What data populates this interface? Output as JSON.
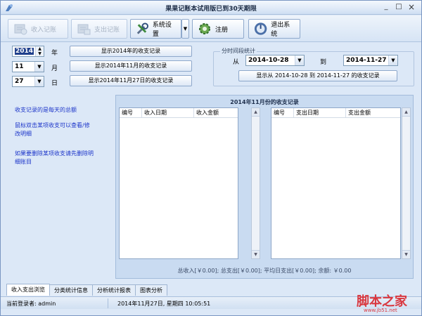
{
  "window": {
    "title": "果果记账本试用版已到30天期限",
    "minimize": "_",
    "maximize": "□",
    "close": "×"
  },
  "toolbar": {
    "income_record": "收入记账",
    "expense_record": "支出记账",
    "settings": "系统设置",
    "settings_drop": "▼",
    "register": "注册",
    "exit": "退出系统"
  },
  "date_selector": {
    "year": "2014",
    "year_unit": "年",
    "month": "11",
    "month_unit": "月",
    "day": "27",
    "day_unit": "日",
    "show_year_btn": "显示2014年的收支记录",
    "show_month_btn": "显示2014年11月的收支记录",
    "show_day_btn": "显示2014年11月27日的收支记录"
  },
  "period": {
    "legend": "分时间段统计",
    "from_label": "从",
    "from_date": "2014-10-28",
    "to_label": "到",
    "to_date": "2014-11-27",
    "show_btn": "显示从 2014-10-28 到 2014-11-27 的收支记录"
  },
  "tips": {
    "line1": "收支记录的是每天的总额",
    "line2a": "鼠标双击某项收支可以查看/修",
    "line2b": "改明细",
    "line3a": "如果要删除某项收支请先删除明",
    "line3b": "细账目"
  },
  "panel": {
    "title": "2014年11月份的收支记录",
    "income_columns": [
      "编号",
      "收入日期",
      "收入金额"
    ],
    "expense_columns": [
      "编号",
      "支出日期",
      "支出金额"
    ],
    "income_rows": [],
    "expense_rows": [],
    "totals": "总收入[￥0.00]; 总支出[￥0.00]; 平均日支出[￥0.00]; 余额: ￥0.00"
  },
  "tabs": [
    "收入支出浏览",
    "分类统计信息",
    "分析统计报表",
    "图表分析"
  ],
  "active_tab": 0,
  "status": {
    "user": "当前登录者: admin",
    "datetime": "2014年11月27日, 星期四 10:05:51"
  },
  "watermark": {
    "text": "脚本之家",
    "url": "www.jb51.net"
  },
  "colors": {
    "tip_text": "#1b34c9",
    "selection": "#1f3f8c",
    "window_bg": "#dce8f7",
    "watermark": "#d9373f"
  }
}
